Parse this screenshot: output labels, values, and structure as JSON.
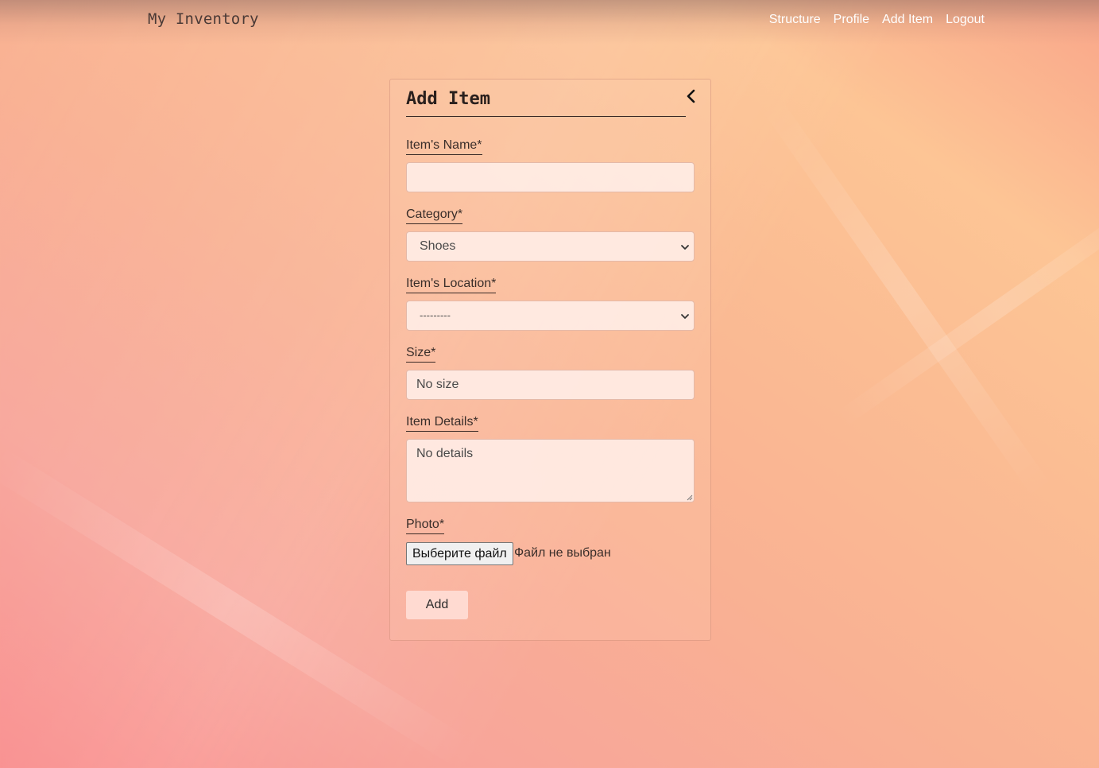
{
  "navbar": {
    "brand": "My Inventory",
    "links": [
      "Structure",
      "Profile",
      "Add Item",
      "Logout"
    ]
  },
  "form": {
    "title": "Add Item",
    "fields": {
      "name": {
        "label": "Item's Name*",
        "value": ""
      },
      "category": {
        "label": "Category*",
        "value": "Shoes"
      },
      "location": {
        "label": "Item's Location*",
        "value": "---------"
      },
      "size": {
        "label": "Size*",
        "value": "No size"
      },
      "details": {
        "label": "Item Details*",
        "value": "No details"
      },
      "photo": {
        "label": "Photo*",
        "button_label": "Выберите файл",
        "status": "Файл не выбран"
      }
    },
    "submit_label": "Add"
  },
  "colors": {
    "label_underline": "#3a2a26",
    "input_bg": "#fff0eb",
    "button_bg": "#ffdcd4"
  }
}
